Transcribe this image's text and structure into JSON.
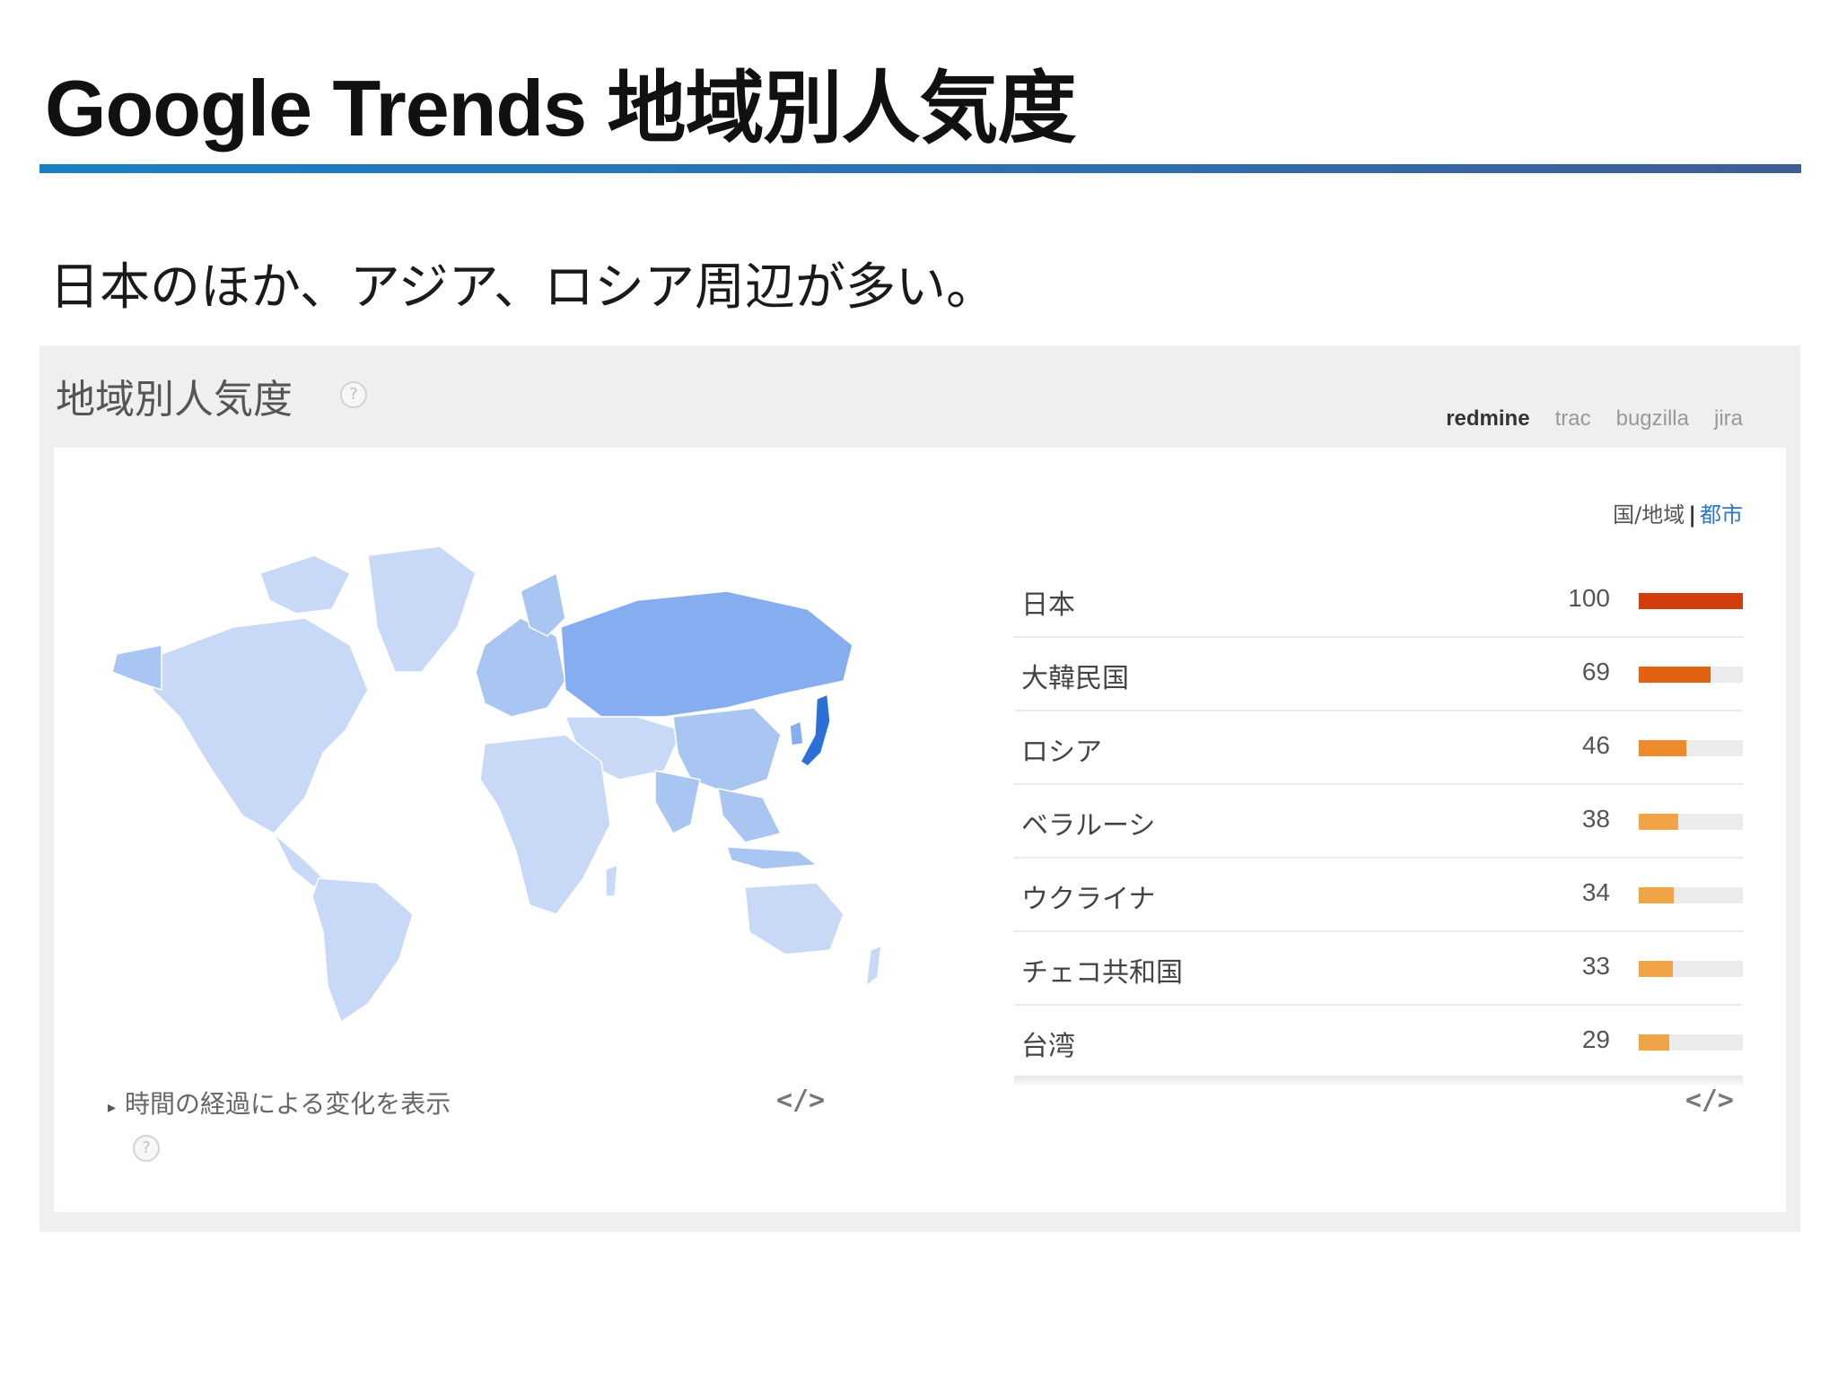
{
  "slide": {
    "title": "Google Trends 地域別人気度",
    "subtitle": "日本のほか、アジア、ロシア周辺が多い。"
  },
  "panel": {
    "title": "地域別人気度",
    "help_icon": "?",
    "tabs": [
      {
        "label": "redmine",
        "active": true
      },
      {
        "label": "trac",
        "active": false
      },
      {
        "label": "bugzilla",
        "active": false
      },
      {
        "label": "jira",
        "active": false
      }
    ],
    "toggle": {
      "country": "国/地域",
      "separator": "|",
      "city": "都市"
    },
    "timeline_link": "時間の経過による変化を表示",
    "timeline_arrow": "▸",
    "embed_icon": "</>"
  },
  "ranking": [
    {
      "name": "日本",
      "value": 100,
      "color": "#d23f0d"
    },
    {
      "name": "大韓民国",
      "value": 69,
      "color": "#e26214"
    },
    {
      "name": "ロシア",
      "value": 46,
      "color": "#ec8a2c"
    },
    {
      "name": "ベラルーシ",
      "value": 38,
      "color": "#f1a446"
    },
    {
      "name": "ウクライナ",
      "value": 34,
      "color": "#f1a446"
    },
    {
      "name": "チェコ共和国",
      "value": 33,
      "color": "#f1a446"
    },
    {
      "name": "台湾",
      "value": 29,
      "color": "#f1a446"
    }
  ],
  "map_colors": {
    "low": "#c7d9f6",
    "medium": "#a9c5f1",
    "high": "#86adf0",
    "top": "#2b6fd8"
  }
}
